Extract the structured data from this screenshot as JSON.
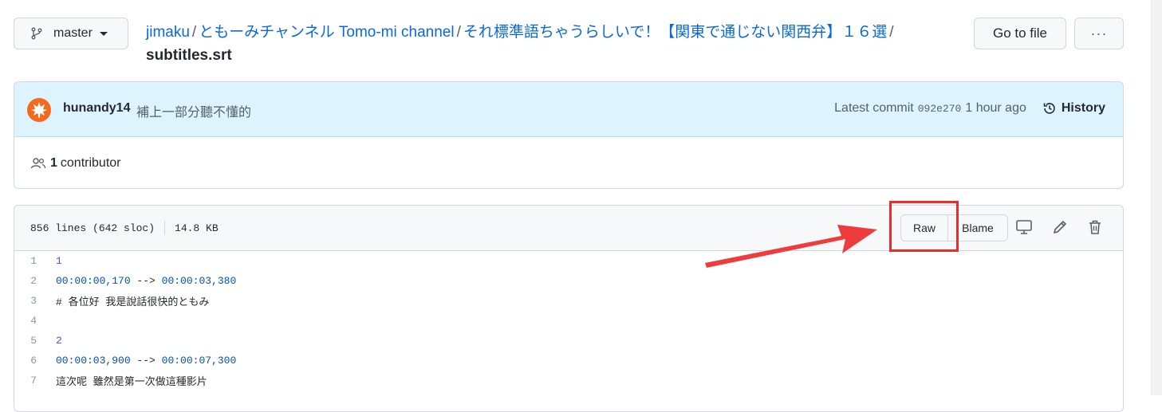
{
  "branch": {
    "label": "master"
  },
  "breadcrumb": {
    "repo": "jimaku",
    "folder1": "ともーみチャンネル Tomo-mi channel",
    "folder2": "それ標準語ちゃうらしいで！【関東で通じない関西弁】１６選",
    "file": "subtitles.srt",
    "sep": "/"
  },
  "toolbar": {
    "goto_label": "Go to file",
    "more_label": "···"
  },
  "commit": {
    "author": "hunandy14",
    "message": "補上一部分聽不懂的",
    "latest_label": "Latest commit",
    "sha": "092e270",
    "time": "1 hour ago",
    "history_label": "History"
  },
  "contributors": {
    "count": "1",
    "label": "contributor"
  },
  "file": {
    "lines_info": "856 lines (642 sloc)",
    "size": "14.8 KB",
    "raw_label": "Raw",
    "blame_label": "Blame"
  },
  "code_lines": [
    {
      "n": "1",
      "text": "1"
    },
    {
      "n": "2",
      "ts1": "00:00:00,170",
      "arrow": " --> ",
      "ts2": "00:00:03,380"
    },
    {
      "n": "3",
      "text": "# 各位好 我是說話很快的ともみ"
    },
    {
      "n": "4",
      "text": ""
    },
    {
      "n": "5",
      "text": "2"
    },
    {
      "n": "6",
      "ts1": "00:00:03,900",
      "arrow": " --> ",
      "ts2": "00:00:07,300"
    },
    {
      "n": "7",
      "text": "這次呢 雖然是第一次做這種影片"
    }
  ],
  "colors": {
    "annotation": "#ee2b2b",
    "link": "#0969da",
    "commit_bar": "#ddf4ff"
  }
}
